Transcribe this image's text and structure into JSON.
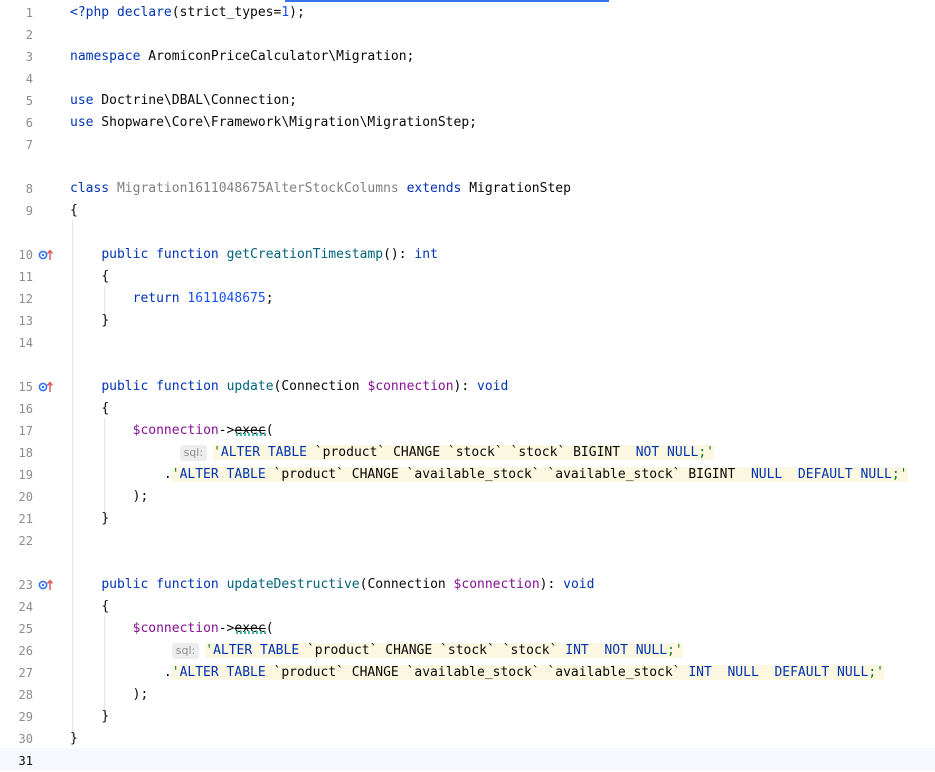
{
  "lines": [
    {
      "n": "1"
    },
    {
      "n": "2"
    },
    {
      "n": "3"
    },
    {
      "n": "4"
    },
    {
      "n": "5"
    },
    {
      "n": "6"
    },
    {
      "n": "7"
    },
    {
      "n": "8"
    },
    {
      "n": "9"
    },
    {
      "n": "10"
    },
    {
      "n": "11"
    },
    {
      "n": "12"
    },
    {
      "n": "13"
    },
    {
      "n": "14"
    },
    {
      "n": "15"
    },
    {
      "n": "16"
    },
    {
      "n": "17"
    },
    {
      "n": "18"
    },
    {
      "n": "19"
    },
    {
      "n": "20"
    },
    {
      "n": "21"
    },
    {
      "n": "22"
    },
    {
      "n": "23"
    },
    {
      "n": "24"
    },
    {
      "n": "25"
    },
    {
      "n": "26"
    },
    {
      "n": "27"
    },
    {
      "n": "28"
    },
    {
      "n": "29"
    },
    {
      "n": "30"
    },
    {
      "n": "31"
    }
  ],
  "code": {
    "php_open": "<?php",
    "declare": "declare",
    "strict_args_open": "(strict_types=",
    "strict_val": "1",
    "strict_args_close": ");",
    "namespace_kw": "namespace",
    "namespace_name": " AromiconPriceCalculator\\Migration;",
    "use_kw": "use",
    "use1": " Doctrine\\DBAL\\Connection;",
    "use2": " Shopware\\Core\\Framework\\Migration\\MigrationStep;",
    "class_kw": "class",
    "class_name": "Migration1611048675AlterStockColumns",
    "extends_kw": "extends",
    "parent_class": "MigrationStep",
    "brace_open": "{",
    "brace_close": "}",
    "public_kw": "public",
    "function_kw": "function",
    "fn1": "getCreationTimestamp",
    "fn1_tail": "(): ",
    "int_kw": "int",
    "return_kw": "return",
    "timestamp": "1611048675",
    "semicolon": ";",
    "fn2": "update",
    "fn3": "updateDestructive",
    "param_open": "(Connection ",
    "param_var": "$connection",
    "param_close": "): ",
    "void_kw": "void",
    "conn_var": "$connection",
    "arrow": "->",
    "exec": "exec",
    "paren_open": "(",
    "close_call": ");",
    "sql_hint": "sql:",
    "dot": ".",
    "quote": "'",
    "quote_semi": ";'",
    "sql_alter": "ALTER TABLE",
    "sql_product": " `product` ",
    "sql_change": "CHANGE",
    "sql_stock": " `stock` `stock` ",
    "sql_bigint": "BIGINT",
    "sql_int": "INT",
    "sql_not_null": "NOT NULL",
    "sql_avail": " `available_stock` `available_stock` ",
    "sql_null": "NULL",
    "sql_default_null": "DEFAULT NULL",
    "sp2": "  "
  }
}
